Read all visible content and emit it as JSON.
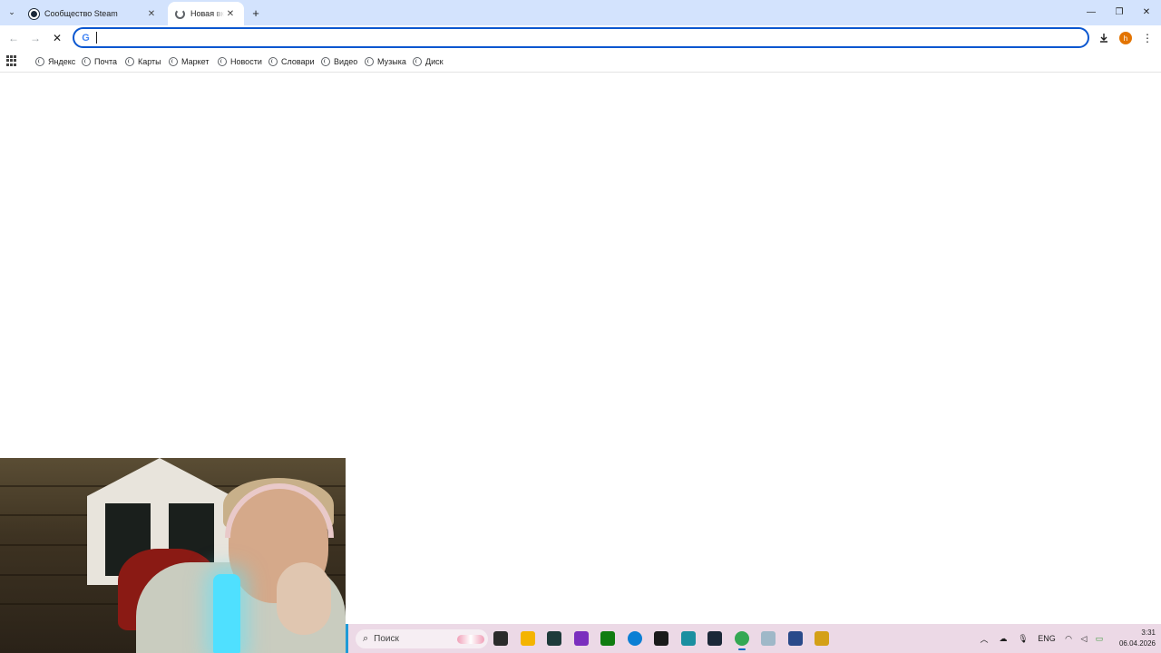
{
  "browser": {
    "tabs": [
      {
        "title": "Сообщество Steam",
        "active": false,
        "favicon": "steam-icon"
      },
      {
        "title": "Новая вкладка",
        "active": true,
        "favicon": "loading-icon"
      }
    ],
    "omnibox": {
      "value": "",
      "placeholder": "",
      "engine_icon": "google-icon"
    },
    "nav": {
      "back": "←",
      "forward": "→",
      "stop": "✕"
    },
    "toolbar_icons": {
      "download": "download-icon",
      "avatar_letter": "h",
      "menu": "⋮"
    },
    "window_controls": {
      "minimize": "—",
      "restore": "❐",
      "close": "✕"
    },
    "new_tab": "+",
    "tab_search": "⌄"
  },
  "bookmarks": [
    {
      "label": "Яндекс"
    },
    {
      "label": "Почта"
    },
    {
      "label": "Карты"
    },
    {
      "label": "Маркет"
    },
    {
      "label": "Новости"
    },
    {
      "label": "Словари"
    },
    {
      "label": "Видео"
    },
    {
      "label": "Музыка"
    },
    {
      "label": "Диск"
    }
  ],
  "taskbar": {
    "search_label": "Поиск",
    "apps": [
      {
        "name": "task-view-icon",
        "color": "#2b2b2b"
      },
      {
        "name": "file-explorer-icon",
        "color": "#f4b400"
      },
      {
        "name": "media-app-icon",
        "color": "#1e3a3a"
      },
      {
        "name": "instagram-icon",
        "color": "#7b2fbe"
      },
      {
        "name": "xbox-icon",
        "color": "#107c10"
      },
      {
        "name": "edge-icon",
        "color": "#0b7fd4"
      },
      {
        "name": "game-launcher-icon",
        "color": "#1a1a1a"
      },
      {
        "name": "notepad-icon",
        "color": "#1a8fa0"
      },
      {
        "name": "steam-icon",
        "color": "#1b2838"
      },
      {
        "name": "chrome-icon",
        "color": "#34a853"
      },
      {
        "name": "cloud-app-icon",
        "color": "#9fb8c8"
      },
      {
        "name": "k-app-icon",
        "color": "#2a4a8a"
      },
      {
        "name": "lock-app-icon",
        "color": "#d4a017"
      }
    ],
    "tray": {
      "language": "ENG",
      "time": "3:31",
      "date": "06.04.2026"
    }
  }
}
